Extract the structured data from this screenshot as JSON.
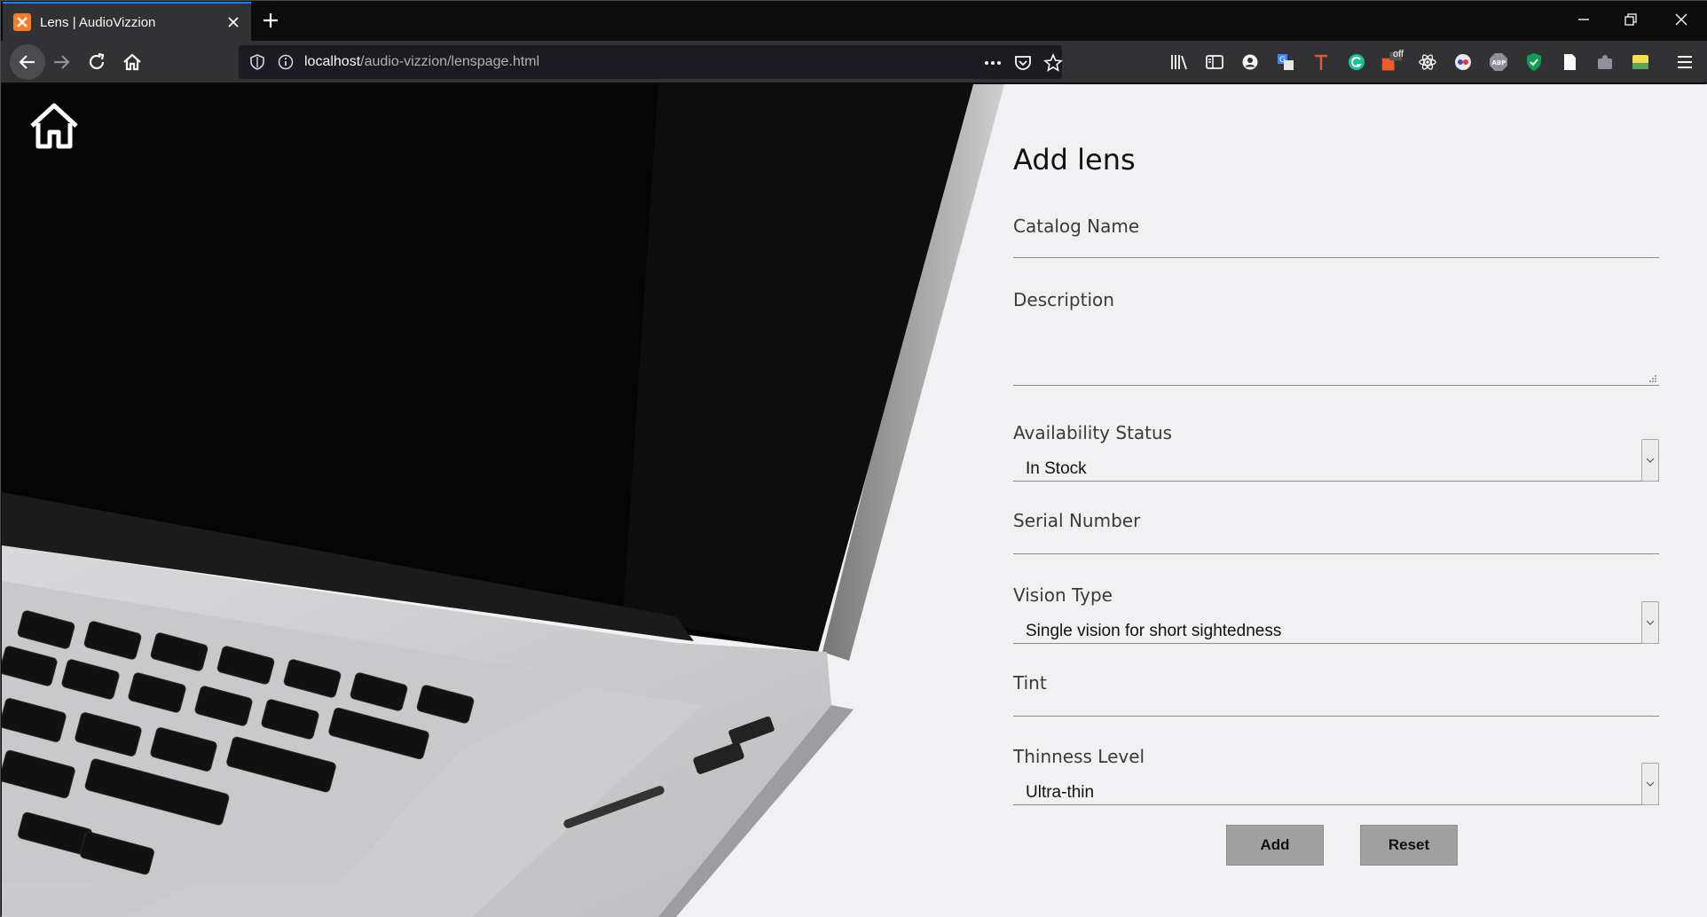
{
  "browser": {
    "tab_title": "Lens | AudioVizzion",
    "url_host": "localhost",
    "url_path": "/audio-vizzion/lenspage.html",
    "accent_color": "#0a84ff",
    "extension_badge": "off"
  },
  "page": {
    "form_title": "Add lens",
    "fields": {
      "catalog_name": {
        "label": "Catalog Name",
        "value": ""
      },
      "description": {
        "label": "Description",
        "value": ""
      },
      "availability_status": {
        "label": "Availability Status",
        "selected": "In Stock"
      },
      "serial_number": {
        "label": "Serial Number",
        "value": ""
      },
      "vision_type": {
        "label": "Vision Type",
        "selected": "Single vision for short sightedness"
      },
      "tint": {
        "label": "Tint",
        "value": ""
      },
      "thinness_level": {
        "label": "Thinness Level",
        "selected": "Ultra-thin"
      }
    },
    "buttons": {
      "add": "Add",
      "reset": "Reset"
    }
  }
}
